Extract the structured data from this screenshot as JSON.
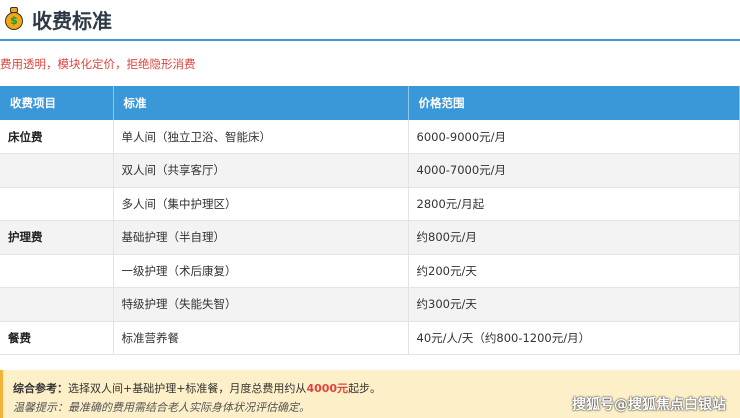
{
  "title": "收费标准",
  "subtitle": "费用透明，模块化定价，拒绝隐形消费",
  "table": {
    "headers": [
      "收费项目",
      "标准",
      "价格范围"
    ],
    "rows": [
      [
        "床位费",
        "单人间（独立卫浴、智能床）",
        "6000-9000元/月"
      ],
      [
        "",
        "双人间（共享客厅）",
        "4000-7000元/月"
      ],
      [
        "",
        "多人间（集中护理区）",
        "2800元/月起"
      ],
      [
        "护理费",
        "基础护理（半自理）",
        "约800元/月"
      ],
      [
        "",
        "一级护理（术后康复）",
        "约200元/天"
      ],
      [
        "",
        "特级护理（失能失智）",
        "约300元/天"
      ],
      [
        "餐费",
        "标准营养餐",
        "40元/人/天（约800-1200元/月）"
      ]
    ]
  },
  "note": {
    "label": "综合参考：",
    "text1": "选择双人间+基础护理+标准餐，月度总费用约从",
    "highlight": "4000元",
    "text2": "起步。",
    "tip": "温馨提示：最准确的费用需结合老人实际身体状况评估确定。"
  },
  "watermark": "搜狐号@搜狐焦点白银站"
}
